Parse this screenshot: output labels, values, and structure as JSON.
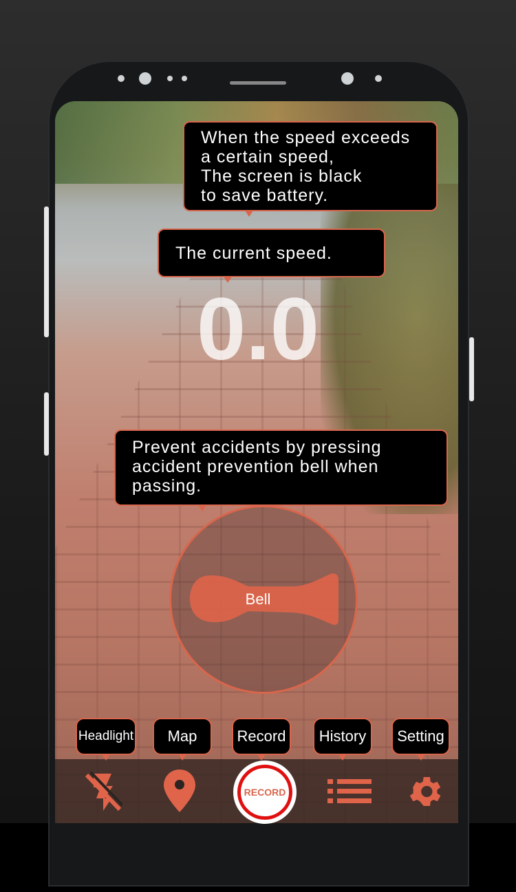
{
  "colors": {
    "accent": "#d9664c",
    "record_ring": "#e01010"
  },
  "tooltips": {
    "battery": [
      "When the speed exceeds",
      "a certain speed,",
      "The screen is black",
      "to save battery."
    ],
    "speed": "The current speed.",
    "bell": [
      "Prevent accidents by pressing",
      "accident prevention bell when",
      "passing."
    ]
  },
  "speed": {
    "value": "0.0"
  },
  "bell": {
    "label": "Bell"
  },
  "nav": {
    "labels": [
      "Headlight",
      "Map",
      "Record",
      "History",
      "Setting"
    ],
    "record_button": "RECORD",
    "icons": [
      "flash-off-icon",
      "map-pin-icon",
      "record-icon",
      "list-icon",
      "gear-icon"
    ]
  }
}
